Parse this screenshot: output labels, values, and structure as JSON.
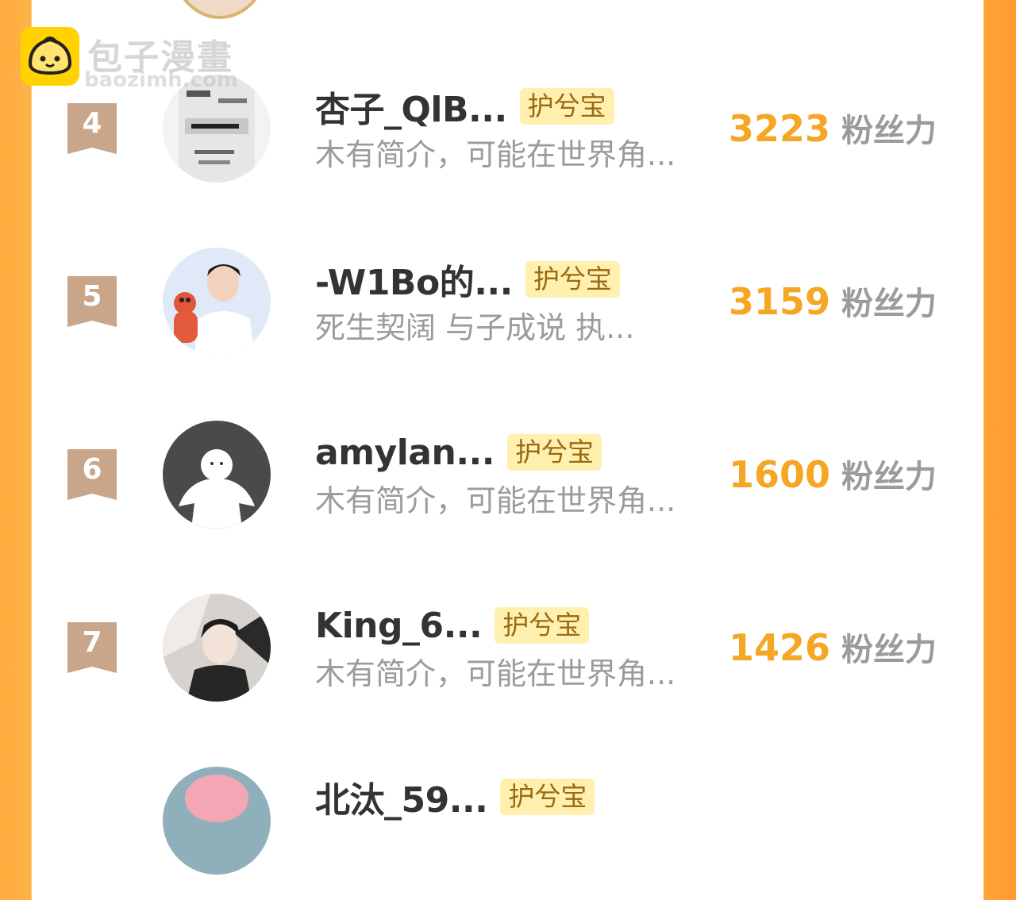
{
  "watermark": {
    "title": "包子漫畫",
    "sub": "baozimh.com"
  },
  "ranking": [
    {
      "rank": "4",
      "name": "杏子_QlB...",
      "tag": "护兮宝",
      "desc": "木有简介，可能在世界角...",
      "score": "3223",
      "unit": "粉丝力",
      "avatar": "calligraphy-poster-avatar"
    },
    {
      "rank": "5",
      "name": "-W1Bo的...",
      "tag": "护兮宝",
      "desc": "死生契阔 与子成说 执...",
      "score": "3159",
      "unit": "粉丝力",
      "avatar": "person-with-bear-plush-avatar"
    },
    {
      "rank": "6",
      "name": "amylan...",
      "tag": "护兮宝",
      "desc": "木有简介，可能在世界角...",
      "score": "1600",
      "unit": "粉丝力",
      "avatar": "default-user-avatar"
    },
    {
      "rank": "7",
      "name": "King_6...",
      "tag": "护兮宝",
      "desc": "木有简介，可能在世界角...",
      "score": "1426",
      "unit": "粉丝力",
      "avatar": "dark-haired-anime-avatar"
    },
    {
      "rank": "",
      "name": "北汰_59...",
      "tag": "护兮宝",
      "desc": "",
      "score": "",
      "unit": "",
      "avatar": "pink-anime-avatar"
    }
  ],
  "colors": {
    "accent": "#f5a623",
    "side_bg": "#ffa53a",
    "tag_bg": "#fff0b0",
    "rank_ribbon": "#c9a58a"
  }
}
